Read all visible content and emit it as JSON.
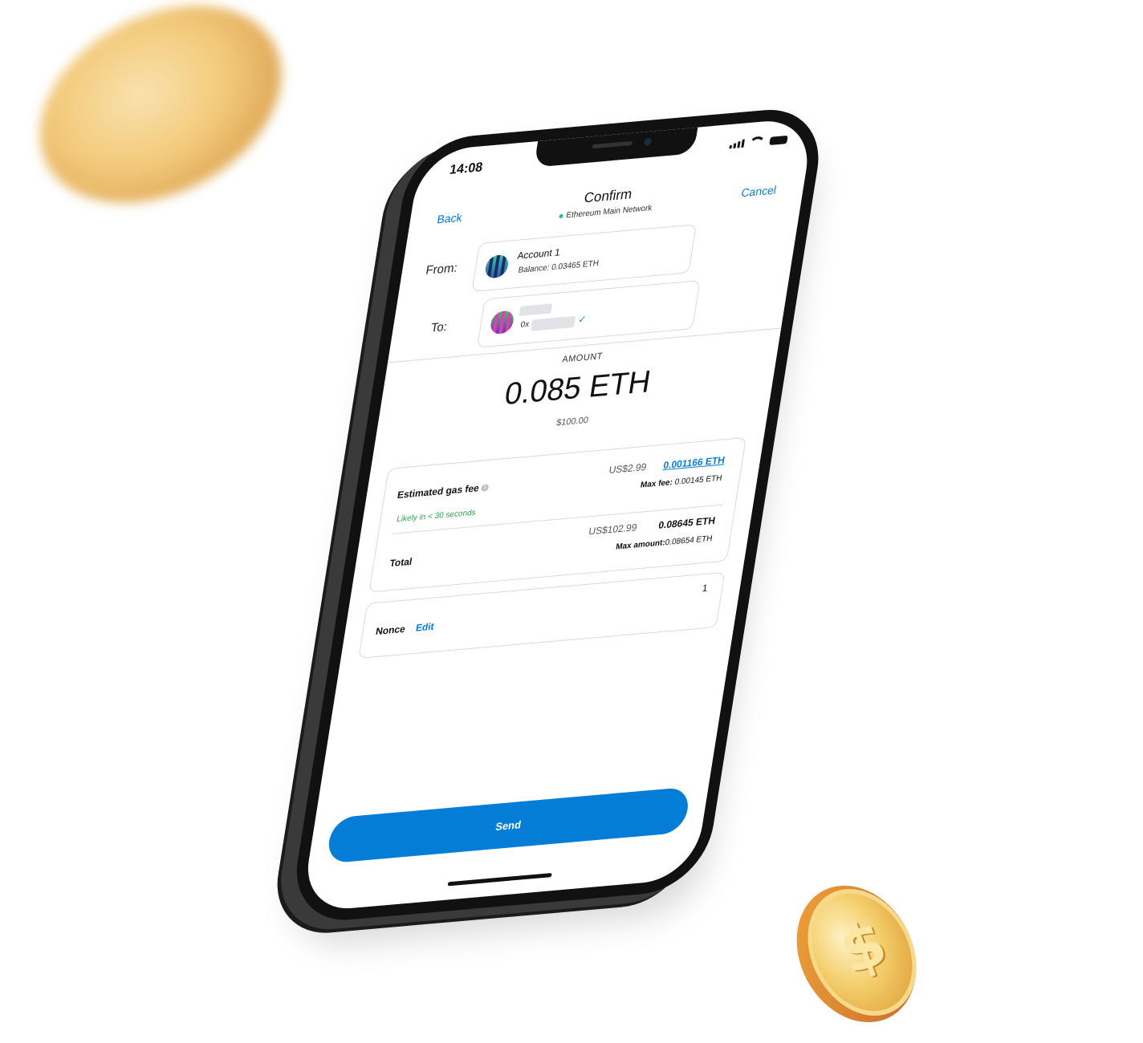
{
  "status": {
    "time": "14:08"
  },
  "nav": {
    "back": "Back",
    "title": "Confirm",
    "network": "Ethereum Main Network",
    "cancel": "Cancel"
  },
  "from": {
    "label": "From:",
    "account_name": "Account 1",
    "balance": "Balance: 0.03465 ETH"
  },
  "to": {
    "label": "To:",
    "address_prefix": "0x"
  },
  "amount": {
    "label": "AMOUNT",
    "value": "0.085 ETH",
    "fiat": "$100.00"
  },
  "gas": {
    "title": "Estimated gas fee",
    "fiat": "US$2.99",
    "eth": "0.001166 ETH",
    "max_fee_label": "Max fee:",
    "max_fee_value": "0.00145 ETH",
    "likely": "Likely in < 30 seconds"
  },
  "total": {
    "label": "Total",
    "fiat": "US$102.99",
    "eth": "0.08645 ETH",
    "max_amount_label": "Max amount:",
    "max_amount_value": "0.08654 ETH"
  },
  "nonce": {
    "label": "Nonce",
    "edit": "Edit",
    "value": "1"
  },
  "send_label": "Send",
  "colors": {
    "accent": "#037dd6",
    "success": "#28a745",
    "network_dot": "#29b6af"
  },
  "icons": [
    "info-icon",
    "check-icon",
    "signal-icon",
    "wifi-icon",
    "battery-icon",
    "dollar-coin-icon"
  ]
}
